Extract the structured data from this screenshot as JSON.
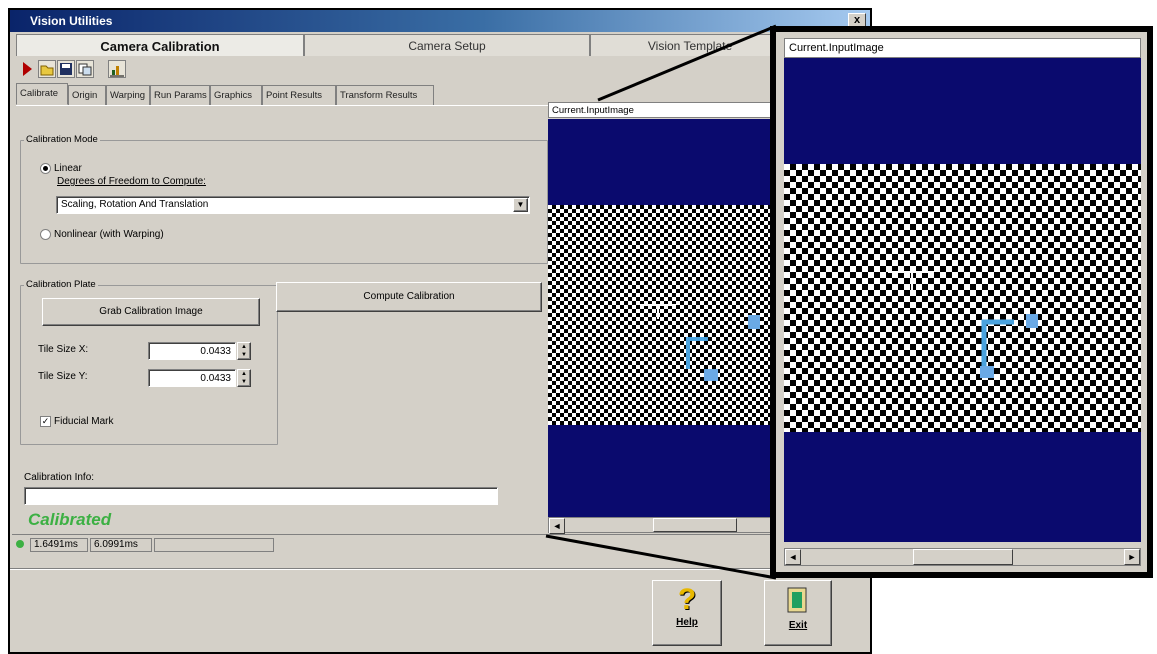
{
  "window": {
    "title": "Vision Utilities",
    "close": "x"
  },
  "tabs": [
    "Camera Calibration",
    "Camera Setup",
    "Vision Template"
  ],
  "toolbar": {
    "icons": [
      "run-icon",
      "open-folder-icon",
      "save-icon",
      "copy-icon",
      "chart-icon"
    ]
  },
  "subtabs": [
    "Calibrate",
    "Origin",
    "Warping",
    "Run Params",
    "Graphics",
    "Point Results",
    "Transform Results"
  ],
  "calibration_mode": {
    "label": "Calibration Mode",
    "linear": "Linear",
    "dof_label": "Degrees of Freedom to Compute:",
    "dof_value": "Scaling, Rotation And Translation",
    "nonlinear": "Nonlinear (with Warping)"
  },
  "calibration_plate": {
    "label": "Calibration Plate",
    "grab_button": "Grab Calibration Image",
    "tile_x_label": "Tile Size X:",
    "tile_x_value": "0.0433",
    "tile_y_label": "Tile Size Y:",
    "tile_y_value": "0.0433",
    "fiducial": "Fiducial Mark"
  },
  "compute_button": "Compute Calibration",
  "calibration_info": {
    "label": "Calibration Info:",
    "value": ""
  },
  "status_text": "Calibrated",
  "statusbar": {
    "time1": "1.6491ms",
    "time2": "6.0991ms"
  },
  "image_view": {
    "title": "Current.InputImage"
  },
  "zoom_view": {
    "title": "Current.InputImage"
  },
  "bottom_buttons": {
    "help": "Help",
    "exit": "Exit"
  },
  "colors": {
    "image_background": "#0a0a6e",
    "axis_color": "#4aa3df",
    "status_green": "#3cb043"
  }
}
